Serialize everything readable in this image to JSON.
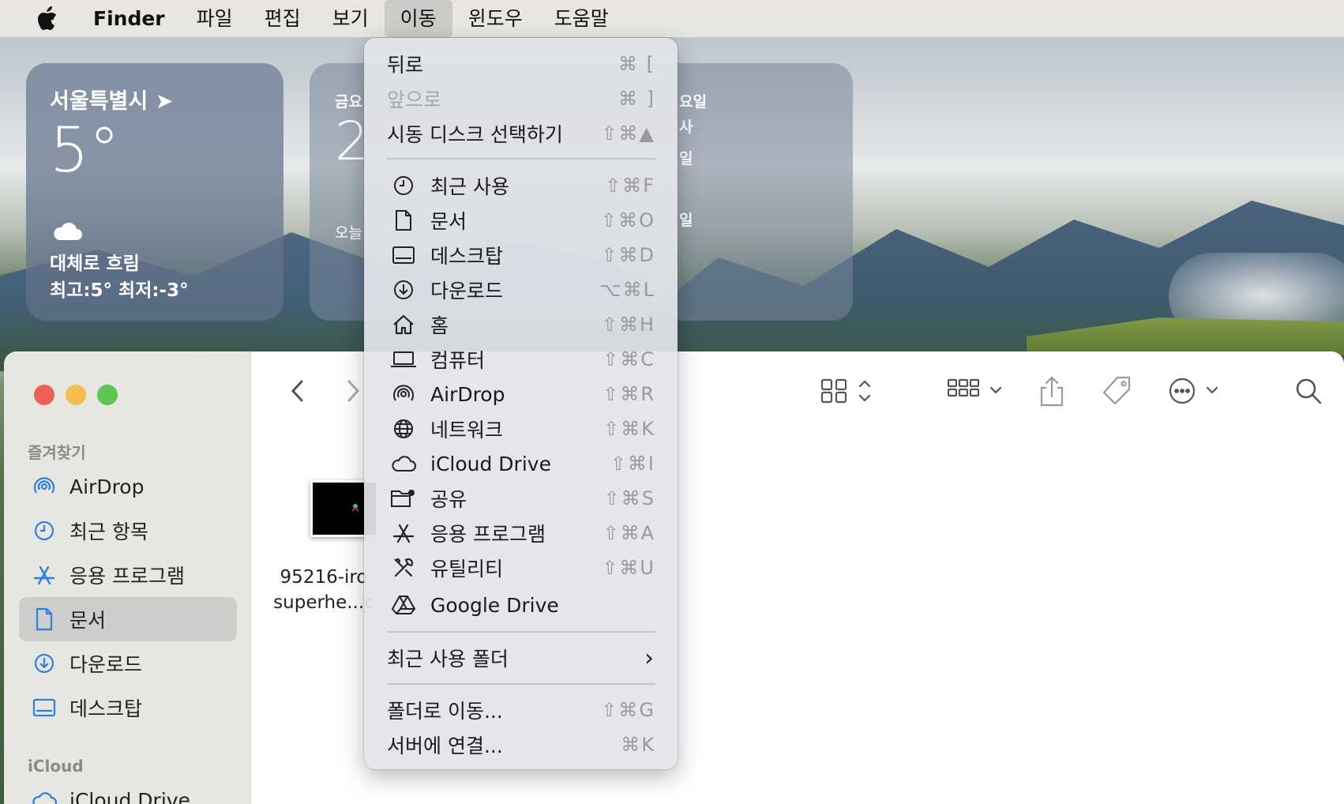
{
  "menubar": {
    "apple_icon": "apple-logo",
    "app_name": "Finder",
    "items": [
      "파일",
      "편집",
      "보기",
      "이동",
      "윈도우",
      "도움말"
    ],
    "active_item": "이동"
  },
  "widgets": {
    "weather": {
      "city": "서울특별시 ➤",
      "temp": "5°",
      "condition": "대체로 흐림",
      "high_low": "최고:5° 최저:-3°",
      "icon": "cloud-icon"
    },
    "calendar": {
      "day": "금요",
      "big": "2",
      "today": "오늘",
      "right_day": "요일",
      "right_line2": "사",
      "right_line3": "일",
      "right_line4": "일"
    }
  },
  "go_menu": {
    "back": {
      "label": "뒤로",
      "shortcut": "⌘ ["
    },
    "forward": {
      "label": "앞으로",
      "shortcut": "⌘ ]"
    },
    "startup_disk": {
      "label": "시동 디스크 선택하기",
      "shortcut": "⇧⌘▲"
    },
    "recents": {
      "label": "최근 사용",
      "shortcut": "⇧⌘F",
      "icon": "clock-icon"
    },
    "documents": {
      "label": "문서",
      "shortcut": "⇧⌘O",
      "icon": "document-icon"
    },
    "desktop": {
      "label": "데스크탑",
      "shortcut": "⇧⌘D",
      "icon": "desktop-icon"
    },
    "downloads": {
      "label": "다운로드",
      "shortcut": "⌥⌘L",
      "icon": "download-icon"
    },
    "home": {
      "label": "홈",
      "shortcut": "⇧⌘H",
      "icon": "house-icon"
    },
    "computer": {
      "label": "컴퓨터",
      "shortcut": "⇧⌘C",
      "icon": "laptop-icon"
    },
    "airdrop": {
      "label": "AirDrop",
      "shortcut": "⇧⌘R",
      "icon": "airdrop-icon"
    },
    "network": {
      "label": "네트워크",
      "shortcut": "⇧⌘K",
      "icon": "globe-icon"
    },
    "icloud": {
      "label": "iCloud Drive",
      "shortcut": "⇧⌘I",
      "icon": "cloud-icon"
    },
    "shared": {
      "label": "공유",
      "shortcut": "⇧⌘S",
      "icon": "shared-folder-icon"
    },
    "applications": {
      "label": "응용 프로그램",
      "shortcut": "⇧⌘A",
      "icon": "apps-icon"
    },
    "utilities": {
      "label": "유틸리티",
      "shortcut": "⇧⌘U",
      "icon": "tools-icon"
    },
    "google_drive": {
      "label": "Google Drive",
      "shortcut": "",
      "icon": "google-drive-icon"
    },
    "recent_folders": {
      "label": "최근 사용 폴더",
      "shortcut": "›"
    },
    "go_to_folder": {
      "label": "폴더로 이동...",
      "shortcut": "⇧⌘G"
    },
    "connect_server": {
      "label": "서버에 연결...",
      "shortcut": "⌘K"
    }
  },
  "sidebar": {
    "favorites_header": "즐겨찾기",
    "items": [
      {
        "label": "AirDrop",
        "icon": "airdrop-icon"
      },
      {
        "label": "최근 항목",
        "icon": "clock-icon"
      },
      {
        "label": "응용 프로그램",
        "icon": "apps-icon"
      },
      {
        "label": "문서",
        "icon": "document-icon",
        "selected": true
      },
      {
        "label": "다운로드",
        "icon": "download-icon"
      },
      {
        "label": "데스크탑",
        "icon": "desktop-icon"
      }
    ],
    "icloud_header": "iCloud",
    "icloud_item": "iCloud Drive"
  },
  "content": {
    "file_name_line1": "95216-iro",
    "file_name_line2": "superhe...c"
  },
  "colors": {
    "accent": "#2f7fe0",
    "traffic_red": "#ed5f57",
    "traffic_yellow": "#f4bd4f",
    "traffic_green": "#5fc452"
  }
}
